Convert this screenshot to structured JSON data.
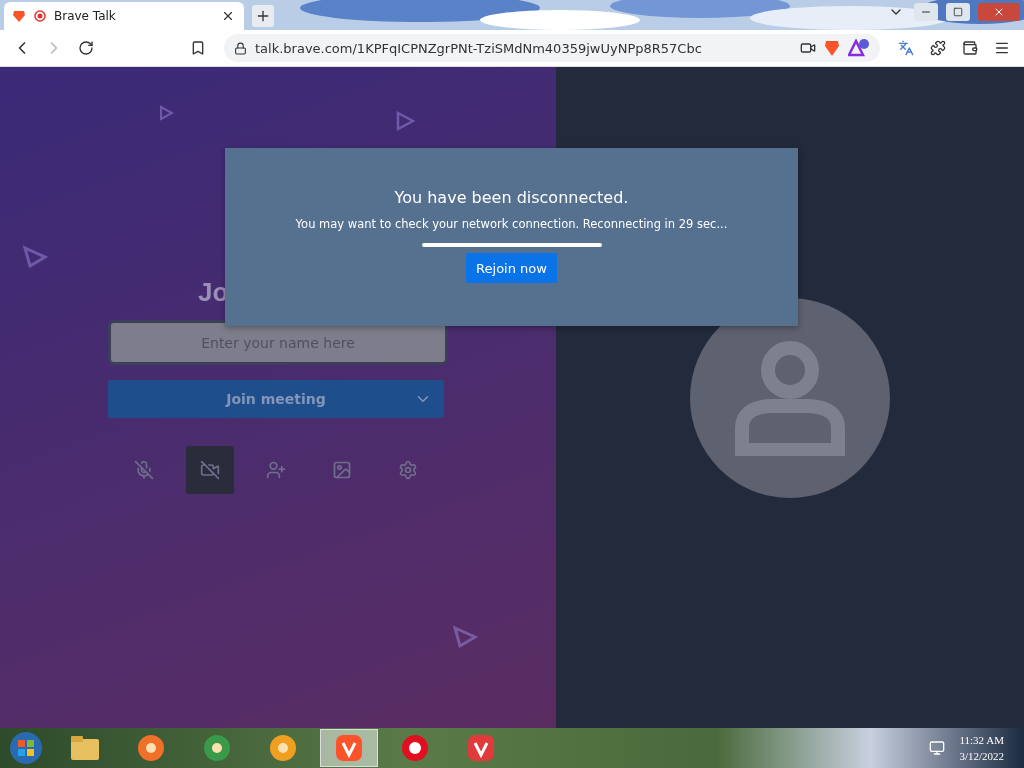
{
  "browser": {
    "tabs": [
      {
        "title": "Brave Talk",
        "selected": true
      }
    ],
    "address": "talk.brave.com/1KPFqICPNZgrPNt-TziSMdNm40359jwUyNPp8R57Cbc",
    "forward_disabled": true
  },
  "prejoin": {
    "heading": "Jo",
    "name_field": {
      "placeholder": "Enter your name here"
    },
    "join_button": "Join meeting",
    "controls": [
      {
        "kind": "mic",
        "selected": false
      },
      {
        "kind": "camera",
        "selected": true
      },
      {
        "kind": "invite",
        "selected": false
      },
      {
        "kind": "background",
        "selected": false
      },
      {
        "kind": "settings",
        "selected": false
      }
    ]
  },
  "dialog": {
    "title": "You have been disconnected.",
    "message": "You may want to check your network connection. Reconnecting in 29 sec...",
    "button": "Rejoin now"
  },
  "taskbar": {
    "apps": [
      {
        "kind": "folder",
        "selected": false
      },
      {
        "kind": "firefox",
        "selected": false
      },
      {
        "kind": "chrome",
        "selected": false
      },
      {
        "kind": "coin",
        "selected": false
      },
      {
        "kind": "brave",
        "selected": true
      },
      {
        "kind": "opera",
        "selected": false
      },
      {
        "kind": "vivaldi",
        "selected": false
      }
    ],
    "time": "11:32 AM",
    "date": "3/12/2022"
  }
}
